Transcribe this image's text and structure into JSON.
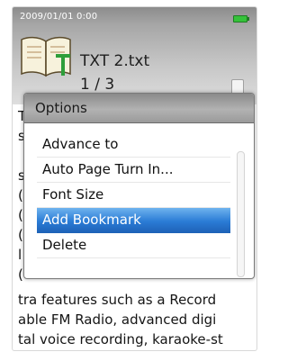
{
  "status_bar": {
    "datetime": "2009/01/01   0:00",
    "battery_icon": "battery-full-icon"
  },
  "file": {
    "name": "TXT 2.txt",
    "page": "1 / 3",
    "icon": "book-text-icon"
  },
  "dialog": {
    "title": "Options",
    "items": [
      {
        "label": "Advance to"
      },
      {
        "label": "Auto Page Turn In..."
      },
      {
        "label": "Font Size"
      },
      {
        "label": "Add Bookmark",
        "selected": true
      },
      {
        "label": "Delete"
      }
    ]
  },
  "reading_text": {
    "lines_visible_left": [
      "T",
      "s",
      "",
      "s",
      "(",
      "(",
      "(",
      "l",
      "(",
      "("
    ],
    "line_1": "tra features such as a Record",
    "line_2": "able FM Radio, advanced digi",
    "line_3": "tal voice recording, karaoke-st"
  },
  "colors": {
    "selection": "#2b7cd6",
    "battery": "#35c23a",
    "header": "#a6a6a6"
  }
}
